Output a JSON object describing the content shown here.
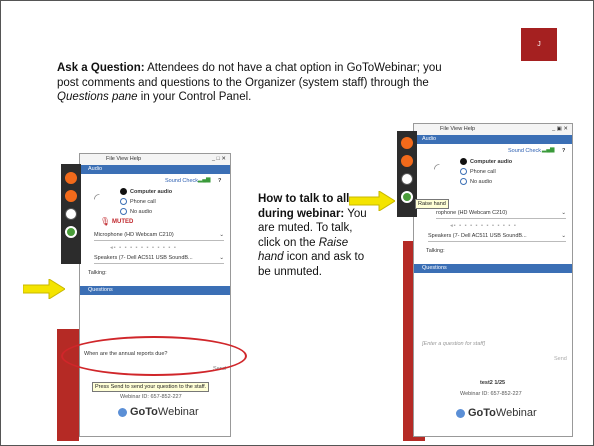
{
  "badge": "J",
  "intro": {
    "heading": "Ask a Question:",
    "part1": " Attendees do not have a chat option in GoToWebinar; you post comments and questions to the Organizer (system staff) through the ",
    "pane": "Questions pane",
    "part2": " in your Control Panel."
  },
  "howto": {
    "heading": "How to talk to all during webinar:",
    "part1": " You are muted. To talk, click on the ",
    "raise": "Raise hand",
    "part2": " icon and ask to be unmuted."
  },
  "left_panel": {
    "menu": "File  View  Help",
    "window_controls": "_ □ ✕",
    "audio_header": "Audio",
    "sound_check": "Sound Check",
    "help": "?",
    "computer_audio": "Computer audio",
    "phone_call": "Phone call",
    "no_audio": "No audio",
    "muted": "MUTED",
    "microphone": "Microphone (HD Webcam C210)",
    "speakers": "Speakers (7- Dell AC511 USB SoundB...",
    "talking": "Talking:",
    "questions_header": "Questions",
    "question_text": "When are the annual reports due?",
    "send": "Send",
    "send_tip": "Press Send to send your question to the staff.",
    "webinar_id": "Webinar ID: 657-852-227",
    "logo_bold": "GoTo",
    "logo_light": "Webinar"
  },
  "right_panel": {
    "menu": "File  View  Help",
    "window_controls": "_ ▣ ✕",
    "audio_header": "Audio",
    "sound_check": "Sound Check",
    "help": "?",
    "computer_audio": "Computer audio",
    "phone_call": "Phone call",
    "no_audio": "No audio",
    "raise_tip": "Raise hand",
    "microphone": "rophone (HD Webcam C210)",
    "speakers": "Speakers (7- Dell AC511 USB SoundB...",
    "talking": "Talking:",
    "questions_header": "Questions",
    "placeholder": "[Enter a question for staff]",
    "send": "Send",
    "session": "test2 1/25",
    "webinar_id": "Webinar ID: 657-852-227",
    "logo_bold": "GoTo",
    "logo_light": "Webinar"
  },
  "colors": {
    "accent_red": "#a52020",
    "header_blue": "#3b6fb5",
    "arrow_yellow": "#f4e400"
  }
}
